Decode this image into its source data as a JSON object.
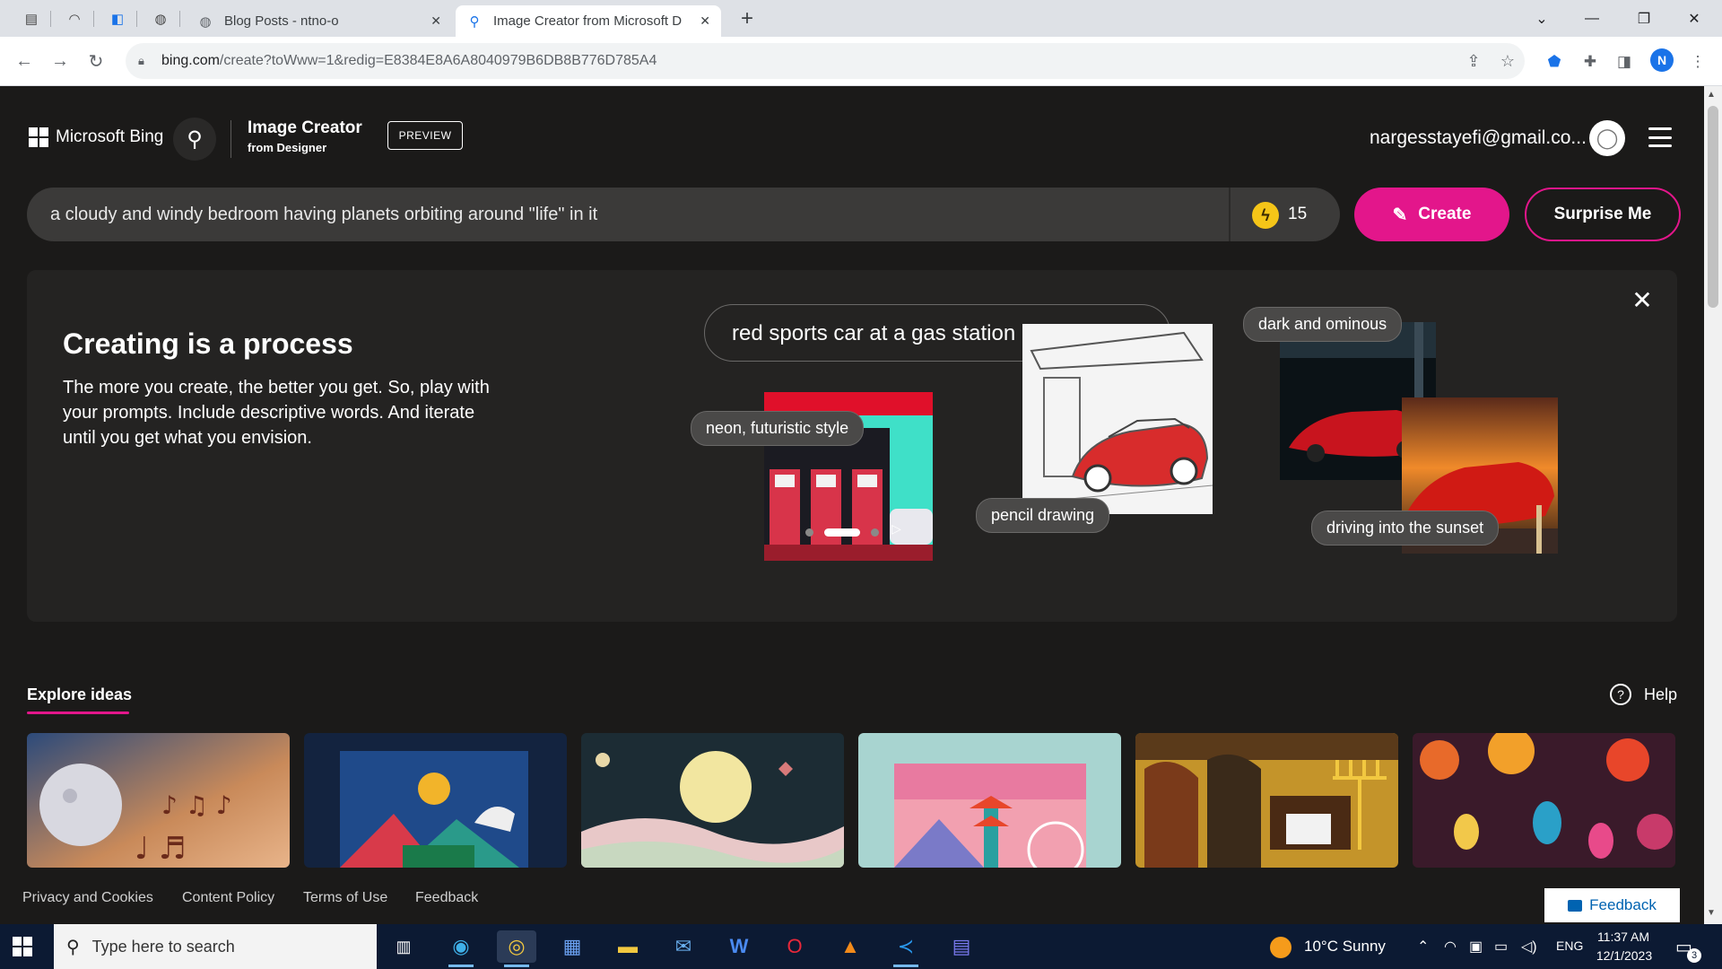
{
  "browser": {
    "tabs": [
      {
        "label": "Blog Posts - ntno-o"
      },
      {
        "label": "Image Creator from Microsoft D"
      }
    ],
    "url_host": "bing.com",
    "url_path": "/create?toWww=1&redig=E8384E8A6A8040979B6DB8B776D785A4",
    "profile_initial": "N"
  },
  "header": {
    "brand": "Microsoft Bing",
    "app_title": "Image Creator",
    "app_subtitle": "from Designer",
    "preview_badge": "PREVIEW",
    "user_email": "nargesstayefi@gmail.co..."
  },
  "prompt": {
    "value": "a cloudy and windy bedroom having planets orbiting around \"life\" in it",
    "boosts": "15",
    "create_label": "Create",
    "surprise_label": "Surprise Me"
  },
  "process_card": {
    "title": "Creating is a process",
    "description": "The more you create, the better you get. So, play with your prompts. Include descriptive words. And iterate until you get what you envision.",
    "demo_prompt": "red sports car at a gas station",
    "chips": {
      "neon": "neon, futuristic style",
      "pencil": "pencil drawing",
      "dark": "dark and ominous",
      "sunset": "driving into the sunset"
    }
  },
  "explore": {
    "tab_label": "Explore ideas",
    "help_label": "Help"
  },
  "footer": {
    "links": [
      "Privacy and Cookies",
      "Content Policy",
      "Terms of Use",
      "Feedback"
    ],
    "feedback_button": "Feedback"
  },
  "taskbar": {
    "search_placeholder": "Type here to search",
    "weather": "10°C  Sunny",
    "language": "ENG",
    "time": "11:37 AM",
    "date": "12/1/2023",
    "notification_count": "3"
  },
  "colors": {
    "accent": "#e3168b",
    "page_bg": "#1b1a19",
    "card_bg": "#242322",
    "prompt_bg": "#3b3a39"
  }
}
